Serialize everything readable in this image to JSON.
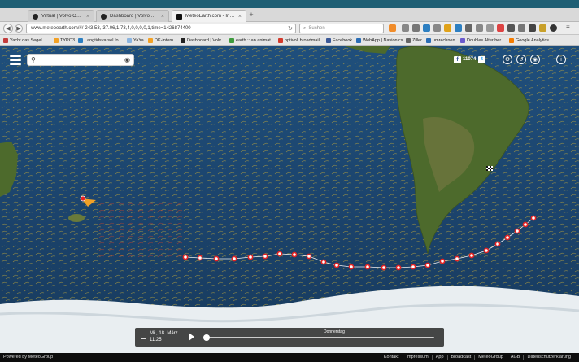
{
  "tabs": [
    {
      "label": "Virtual | Volvo Ocean Race",
      "active": false
    },
    {
      "label": "Dashboard | Volvo Ocean Race",
      "active": false
    },
    {
      "label": "MeteoEarth.com - Interactive Weather",
      "active": true
    }
  ],
  "new_tab": "+",
  "url": "www.meteoearth.com/#/-243.53,-37.06,1.73,4,0,0,0,0,1,time=1426874400",
  "search_placeholder": "Suchen",
  "bookmarks": [
    {
      "label": "Yacht das Segel...",
      "color": "#c23b3b"
    },
    {
      "label": "TYPO3",
      "color": "#f2a126"
    },
    {
      "label": "Langtidsvarsel fo...",
      "color": "#2d7fc1"
    },
    {
      "label": "YaYa",
      "color": "#8ab4e0"
    },
    {
      "label": "DK-intern",
      "color": "#f2a126"
    },
    {
      "label": "Dashboard | Volv...",
      "color": "#222222"
    },
    {
      "label": "earth :: an animat...",
      "color": "#3e9b3e"
    },
    {
      "label": "optivoll broadmail",
      "color": "#d33a2c"
    },
    {
      "label": "Facebook",
      "color": "#3b5998"
    },
    {
      "label": "WebApp | Navionics",
      "color": "#2a6db5"
    },
    {
      "label": "Ziller",
      "color": "#666666"
    },
    {
      "label": "umrechnen",
      "color": "#2a6db5"
    },
    {
      "label": "Doubles Alter ber...",
      "color": "#6a5acd"
    },
    {
      "label": "Google Analytics",
      "color": "#f57c00"
    }
  ],
  "map": {
    "search_value": "",
    "facebook_count": "11074",
    "player": {
      "date_line1": "Mi., 18. März",
      "date_line2": "11:25",
      "day_label": "Donnerstag",
      "progress": 0.0
    }
  },
  "footer": {
    "powered": "Powered by MeteoGroup",
    "links": [
      "Kontakt",
      "Impressum",
      "App",
      "Broadcast",
      "MeteoGroup",
      "AGB",
      "Datenschutzerklärung"
    ]
  },
  "colors": {
    "ocean": "#1c4670",
    "land_green": "#4f6d2c",
    "ice": "#eef2f4",
    "route_marker": "#e52222"
  }
}
